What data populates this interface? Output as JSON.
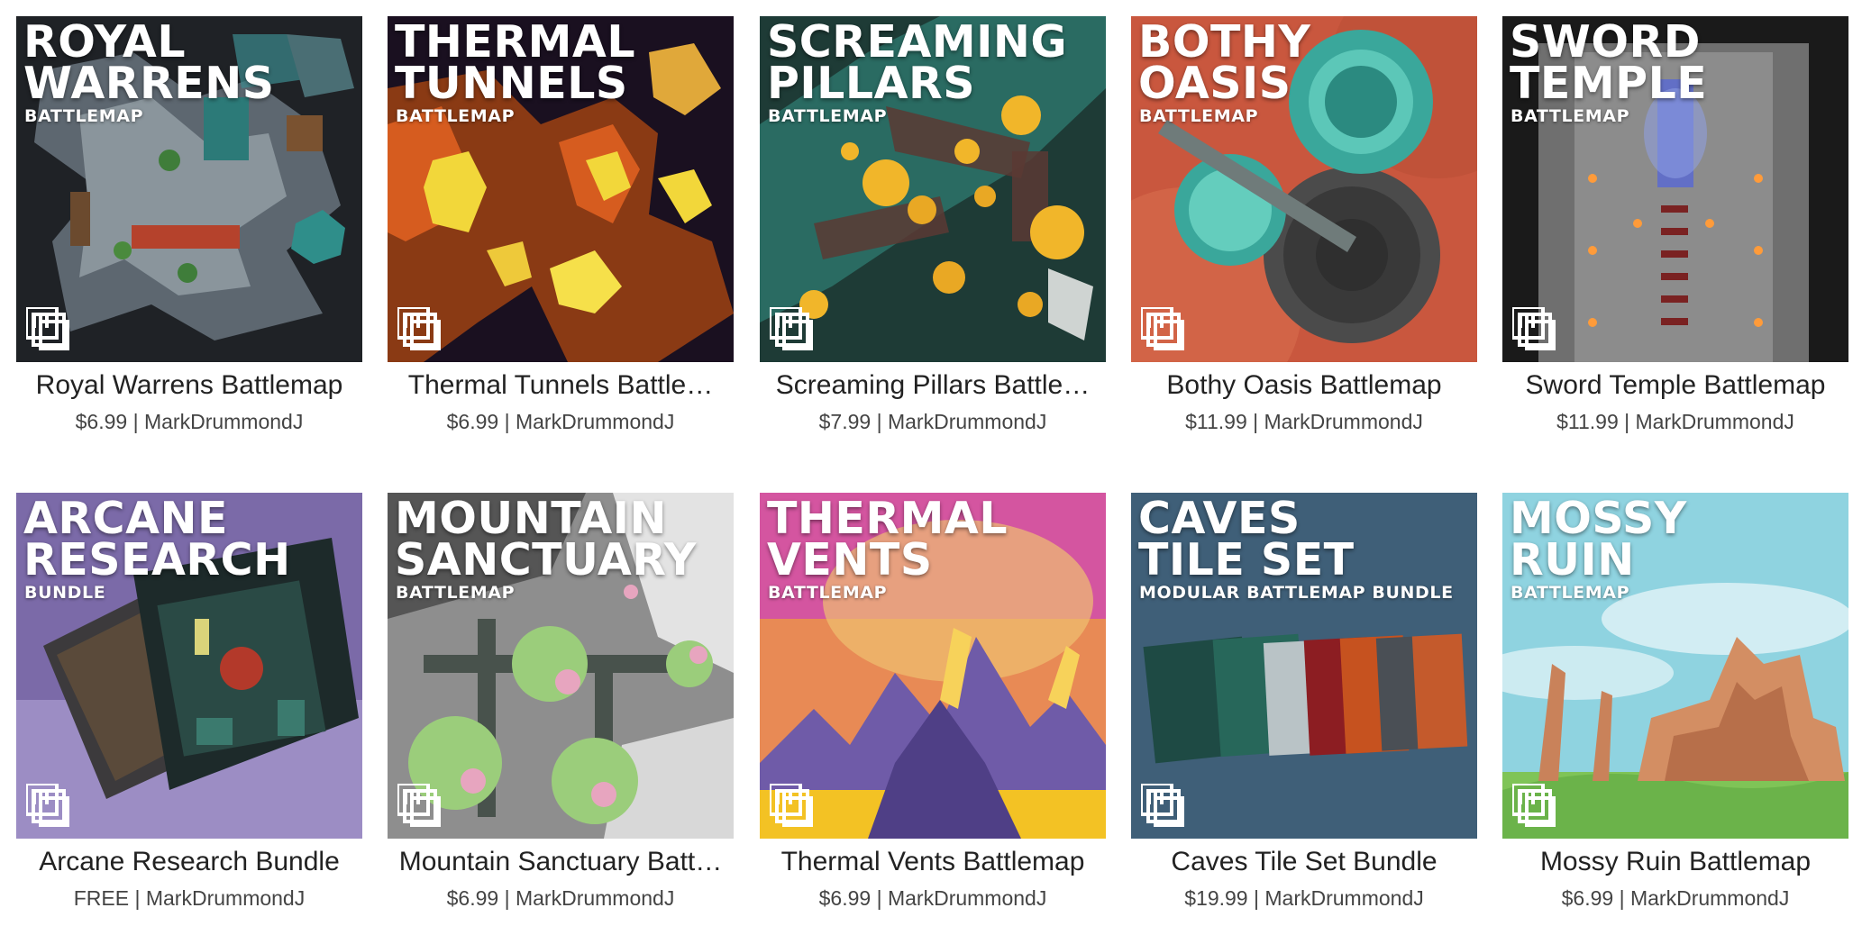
{
  "products": [
    {
      "title_lines": [
        "ROYAL",
        "WARRENS"
      ],
      "badge": "BATTLEMAP",
      "name": "Royal Warrens Battlemap",
      "price": "$6.99",
      "author": "MarkDrummondJ",
      "art": "warrens"
    },
    {
      "title_lines": [
        "THERMAL",
        "TUNNELS"
      ],
      "badge": "BATTLEMAP",
      "name": "Thermal Tunnels Battle…",
      "price": "$6.99",
      "author": "MarkDrummondJ",
      "art": "lava"
    },
    {
      "title_lines": [
        "SCREAMING",
        "PILLARS"
      ],
      "badge": "BATTLEMAP",
      "name": "Screaming Pillars Battle…",
      "price": "$7.99",
      "author": "MarkDrummondJ",
      "art": "pillars"
    },
    {
      "title_lines": [
        "BOTHY",
        "OASIS"
      ],
      "badge": "BATTLEMAP",
      "name": "Bothy Oasis Battlemap",
      "price": "$11.99",
      "author": "MarkDrummondJ",
      "art": "oasis"
    },
    {
      "title_lines": [
        "SWORD",
        "TEMPLE"
      ],
      "badge": "BATTLEMAP",
      "name": "Sword Temple Battlemap",
      "price": "$11.99",
      "author": "MarkDrummondJ",
      "art": "temple"
    },
    {
      "title_lines": [
        "ARCANE",
        "RESEARCH"
      ],
      "badge": "BUNDLE",
      "name": "Arcane Research Bundle",
      "price": "FREE",
      "author": "MarkDrummondJ",
      "art": "arcane"
    },
    {
      "title_lines": [
        "MOUNTAIN",
        "SANCTUARY"
      ],
      "badge": "BATTLEMAP",
      "name": "Mountain Sanctuary Batt…",
      "price": "$6.99",
      "author": "MarkDrummondJ",
      "art": "sanctuary"
    },
    {
      "title_lines": [
        "THERMAL",
        "VENTS"
      ],
      "badge": "BATTLEMAP",
      "name": "Thermal Vents Battlemap",
      "price": "$6.99",
      "author": "MarkDrummondJ",
      "art": "vents"
    },
    {
      "title_lines": [
        "CAVES",
        "TILE SET"
      ],
      "badge": "MODULAR BATTLEMAP BUNDLE",
      "name": "Caves Tile Set Bundle",
      "price": "$19.99",
      "author": "MarkDrummondJ",
      "art": "caves"
    },
    {
      "title_lines": [
        "MOSSY",
        "RUIN"
      ],
      "badge": "BATTLEMAP",
      "name": "Mossy Ruin Battlemap",
      "price": "$6.99",
      "author": "MarkDrummondJ",
      "art": "ruin"
    }
  ]
}
